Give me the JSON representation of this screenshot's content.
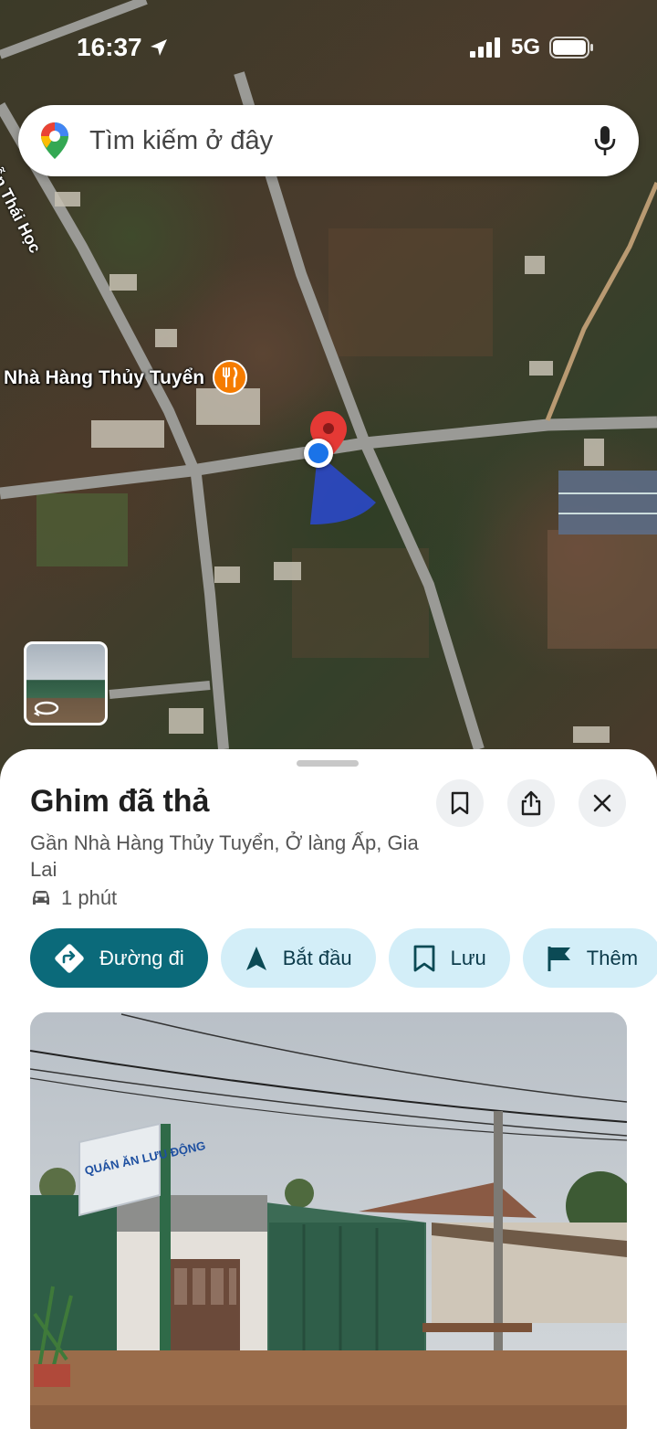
{
  "status_bar": {
    "time": "16:37",
    "network": "5G"
  },
  "search": {
    "placeholder": "Tìm kiếm ở đây",
    "logo_icon": "google-maps-pin-icon",
    "mic_icon": "mic-icon"
  },
  "map": {
    "poi_label": "Nhà Hàng Thủy Tuyển",
    "poi_icon": "restaurant-icon",
    "street_label": "Nguyễn Thái Học"
  },
  "place": {
    "title": "Ghim đã thả",
    "address": "Gần Nhà Hàng Thủy Tuyển, Ở làng Ấp, Gia Lai",
    "drive_time": "1 phút"
  },
  "actions": [
    {
      "label": "Đường đi",
      "icon": "directions-icon"
    },
    {
      "label": "Bắt đầu",
      "icon": "navigation-arrow-icon"
    },
    {
      "label": "Lưu",
      "icon": "bookmark-icon"
    },
    {
      "label": "Thêm",
      "icon": "flag-icon"
    }
  ],
  "photo": {
    "sign_text": "QUÁN ĂN LƯU ĐỘNG"
  },
  "colors": {
    "primary": "#0b6a7a",
    "chip": "#d3eef8",
    "pin": "#e53935",
    "location": "#1a73e8"
  }
}
